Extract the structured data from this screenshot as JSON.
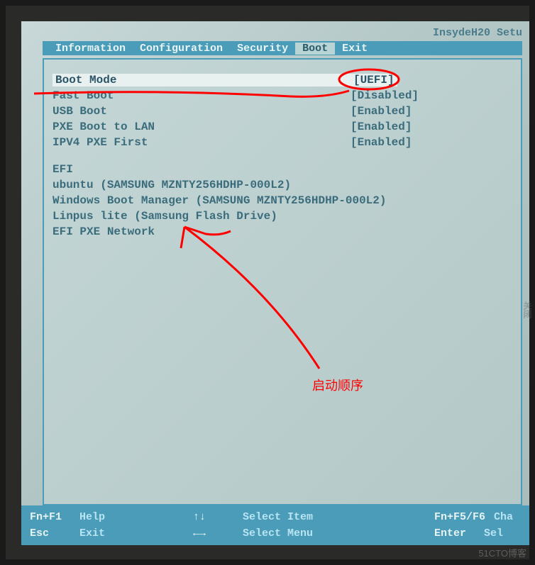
{
  "bios": {
    "title": "InsydeH20 Setu"
  },
  "tabs": [
    {
      "label": "Information"
    },
    {
      "label": "Configuration"
    },
    {
      "label": "Security"
    },
    {
      "label": "Boot",
      "active": true
    },
    {
      "label": "Exit"
    }
  ],
  "settings": [
    {
      "label": "Boot Mode",
      "value": "[UEFI]",
      "highlight": true
    },
    {
      "label": "Fast Boot",
      "value": "[Disabled]"
    },
    {
      "label": "USB Boot",
      "value": "[Enabled]"
    },
    {
      "label": "PXE Boot to LAN",
      "value": "[Enabled]"
    },
    {
      "label": "IPV4 PXE First",
      "value": "[Enabled]"
    }
  ],
  "efi_section": {
    "header": "EFI",
    "entries": [
      "ubuntu (SAMSUNG MZNTY256HDHP-000L2)",
      "Windows Boot Manager (SAMSUNG MZNTY256HDHP-000L2)",
      "Linpus lite (Samsung Flash Drive)",
      "EFI PXE Network"
    ]
  },
  "footer": {
    "left": [
      {
        "key": "Fn+F1",
        "action": "Help"
      },
      {
        "key": "Esc",
        "action": "Exit"
      }
    ],
    "mid": [
      {
        "key": "↑↓",
        "action": "Select Item"
      },
      {
        "key": "←→",
        "action": "Select Menu"
      }
    ],
    "right": [
      {
        "key": "Fn+F5/F6",
        "action": "Cha"
      },
      {
        "key": "Enter",
        "action": "Sel"
      }
    ]
  },
  "annotation": {
    "label": "启动顺序"
  },
  "watermark": "51CTO博客",
  "side_label": "关闭"
}
